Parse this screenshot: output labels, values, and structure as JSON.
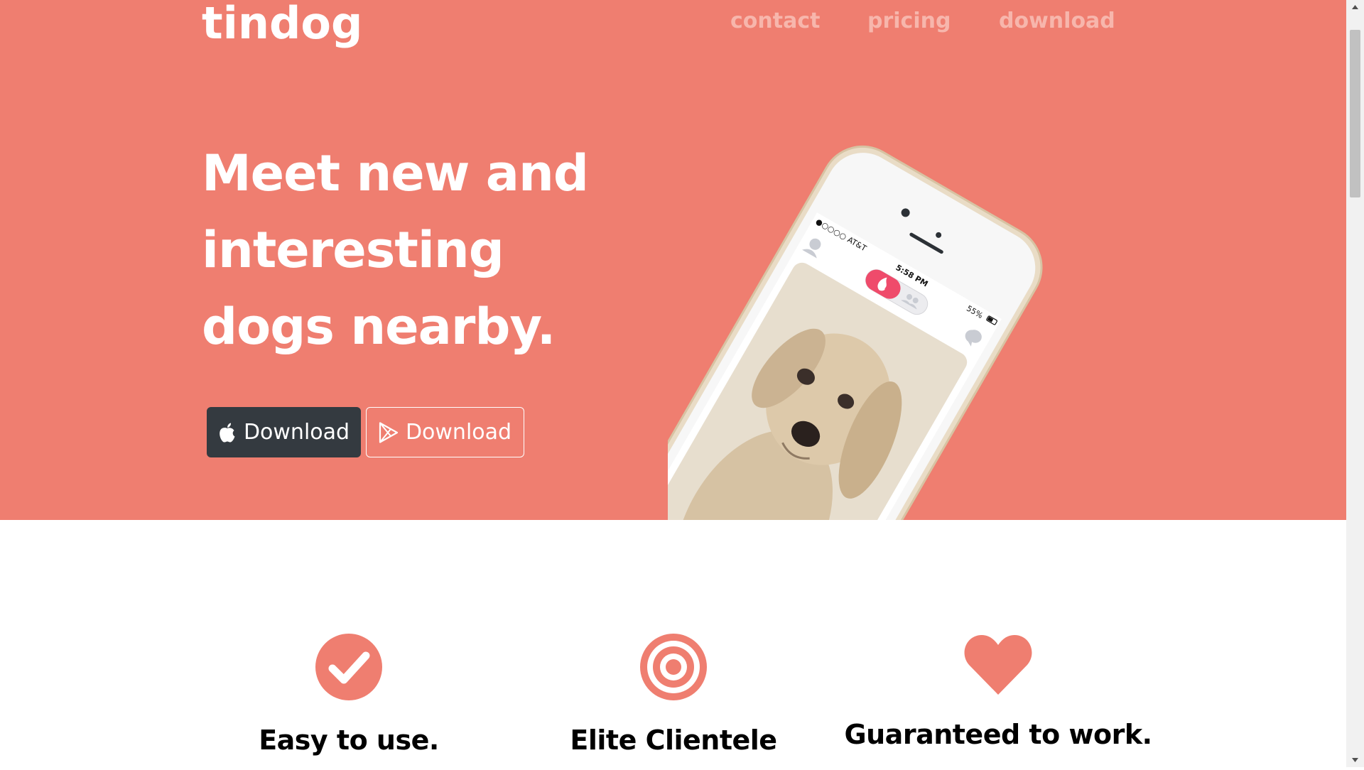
{
  "brand": {
    "name": "tindog"
  },
  "nav": {
    "contact": "contact",
    "pricing": "pricing",
    "download": "download"
  },
  "hero": {
    "headline_line1": "Meet new and",
    "headline_line2": "interesting",
    "headline_line3": "dogs nearby.",
    "apple_button_label": "Download",
    "google_play_button_label": "Download"
  },
  "phone": {
    "carrier": "●○○○○ AT&T",
    "time": "5:58 PM",
    "battery": "55%"
  },
  "features": [
    {
      "icon": "check-circle-icon",
      "title": "Easy to use."
    },
    {
      "icon": "bullseye-icon",
      "title": "Elite Clientele"
    },
    {
      "icon": "heart-icon",
      "title": "Guaranteed to work."
    }
  ],
  "colors": {
    "hero_background": "#ef7e70",
    "dark_button": "#343a40",
    "nav_link": "#f7b6ac",
    "icon_accent": "#ef7e70"
  }
}
